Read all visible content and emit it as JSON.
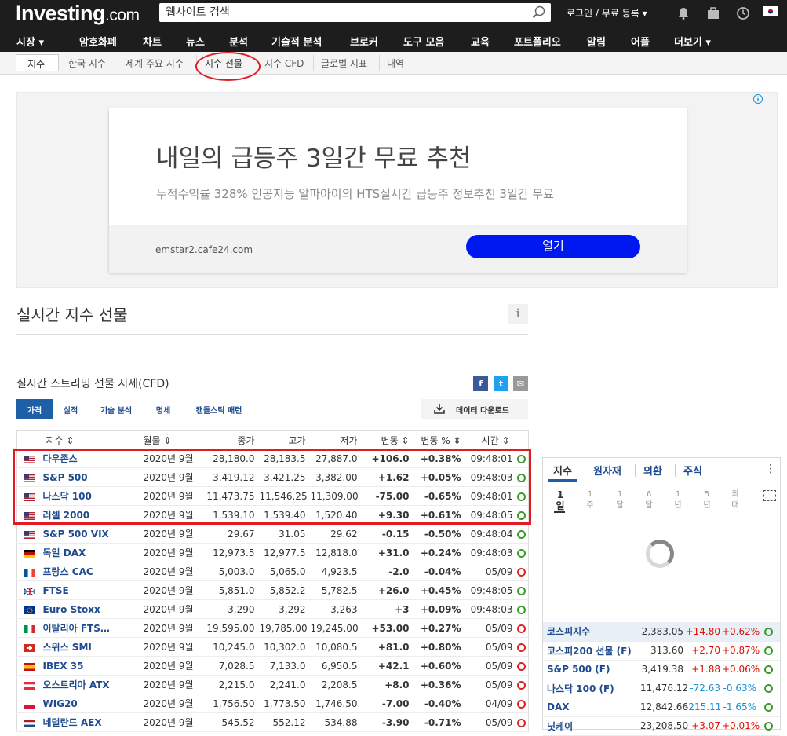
{
  "header": {
    "logo_main": "Investing",
    "logo_suffix": ".com",
    "search_placeholder": "웹사이트 검색",
    "login": "로그인 / 무료 등록",
    "login_arrow": "▾",
    "brand_color": "#1d1d1d"
  },
  "nav": [
    {
      "label": "시장 ▾"
    },
    {
      "label": "암호화폐"
    },
    {
      "label": "차트"
    },
    {
      "label": "뉴스"
    },
    {
      "label": "분석"
    },
    {
      "label": "기술적 분석"
    },
    {
      "label": "브로커"
    },
    {
      "label": "도구 모음"
    },
    {
      "label": "교육"
    },
    {
      "label": "포트폴리오"
    },
    {
      "label": "알림"
    },
    {
      "label": "어플"
    },
    {
      "label": "더보기 ▾"
    }
  ],
  "subnav": {
    "first": "지수",
    "items": [
      "한국 지수",
      "세계 주요 지수",
      "지수 선물",
      "지수 CFD",
      "글로벌 지표",
      "내역"
    ]
  },
  "ad": {
    "title": "내일의 급등주 3일간 무료 추천",
    "subtitle": "누적수익률 328% 인공지능 알파아이의 HTS실시간 급등주 정보추천 3일간 무료",
    "url": "emstar2.cafe24.com",
    "button": "열기",
    "button_color": "#0018f0"
  },
  "page": {
    "title": "실시간 지수 선물",
    "info": "i",
    "table_title": "실시간 스트리밍 선물 시세(CFD)"
  },
  "share": {
    "facebook": "f",
    "twitter": "t",
    "email": "✉"
  },
  "tabs": [
    "가격",
    "실적",
    "기술 분석",
    "명세",
    "캔들스틱 패턴"
  ],
  "download": "데이터 다운로드",
  "table": {
    "headers": {
      "name": "지수 ⇕",
      "month": "월물 ⇕",
      "close": "종가",
      "high": "고가",
      "low": "저가",
      "chg": "변동 ⇕",
      "pct": "변동 % ⇕",
      "time": "시간 ⇕"
    },
    "rows": [
      {
        "flag": "us",
        "name": "다우존스",
        "month": "2020년 9월",
        "close": "28,180.0",
        "high": "28,183.5",
        "low": "27,887.0",
        "chg": "+106.0",
        "pct": "+0.38%",
        "time": "09:48:01",
        "live": true
      },
      {
        "flag": "us",
        "name": "S&P 500",
        "month": "2020년 9월",
        "close": "3,419.12",
        "high": "3,421.25",
        "low": "3,382.00",
        "chg": "+1.62",
        "pct": "+0.05%",
        "time": "09:48:03",
        "live": true
      },
      {
        "flag": "us",
        "name": "나스닥 100",
        "month": "2020년 9월",
        "close": "11,473.75",
        "high": "11,546.25",
        "low": "11,309.00",
        "chg": "-75.00",
        "pct": "-0.65%",
        "time": "09:48:01",
        "live": true
      },
      {
        "flag": "us",
        "name": "러셀 2000",
        "month": "2020년 9월",
        "close": "1,539.10",
        "high": "1,539.40",
        "low": "1,520.40",
        "chg": "+9.30",
        "pct": "+0.61%",
        "time": "09:48:05",
        "live": true
      },
      {
        "flag": "us",
        "name": "S&P 500 VIX",
        "month": "2020년 9월",
        "close": "29.67",
        "high": "31.05",
        "low": "29.62",
        "chg": "-0.15",
        "pct": "-0.50%",
        "time": "09:48:04",
        "live": true
      },
      {
        "flag": "de",
        "name": "독일 DAX",
        "month": "2020년 9월",
        "close": "12,973.5",
        "high": "12,977.5",
        "low": "12,818.0",
        "chg": "+31.0",
        "pct": "+0.24%",
        "time": "09:48:03",
        "live": true
      },
      {
        "flag": "fr",
        "name": "프랑스 CAC",
        "month": "2020년 9월",
        "close": "5,003.0",
        "high": "5,065.0",
        "low": "4,923.5",
        "chg": "-2.0",
        "pct": "-0.04%",
        "time": "05/09",
        "live": false
      },
      {
        "flag": "gb",
        "name": "FTSE",
        "month": "2020년 9월",
        "close": "5,851.0",
        "high": "5,852.2",
        "low": "5,782.5",
        "chg": "+26.0",
        "pct": "+0.45%",
        "time": "09:48:05",
        "live": true
      },
      {
        "flag": "eu",
        "name": "Euro Stoxx",
        "month": "2020년 9월",
        "close": "3,290",
        "high": "3,292",
        "low": "3,263",
        "chg": "+3",
        "pct": "+0.09%",
        "time": "09:48:03",
        "live": true
      },
      {
        "flag": "it",
        "name": "이탈리아 FTS…",
        "month": "2020년 9월",
        "close": "19,595.00",
        "high": "19,785.00",
        "low": "19,245.00",
        "chg": "+53.00",
        "pct": "+0.27%",
        "time": "05/09",
        "live": false
      },
      {
        "flag": "ch",
        "name": "스위스 SMI",
        "month": "2020년 9월",
        "close": "10,245.0",
        "high": "10,302.0",
        "low": "10,080.5",
        "chg": "+81.0",
        "pct": "+0.80%",
        "time": "05/09",
        "live": false
      },
      {
        "flag": "es",
        "name": "IBEX 35",
        "month": "2020년 9월",
        "close": "7,028.5",
        "high": "7,133.0",
        "low": "6,950.5",
        "chg": "+42.1",
        "pct": "+0.60%",
        "time": "05/09",
        "live": false
      },
      {
        "flag": "at",
        "name": "오스트리아 ATX",
        "month": "2020년 9월",
        "close": "2,215.0",
        "high": "2,241.0",
        "low": "2,208.5",
        "chg": "+8.0",
        "pct": "+0.36%",
        "time": "05/09",
        "live": false
      },
      {
        "flag": "pl",
        "name": "WIG20",
        "month": "2020년 9월",
        "close": "1,756.50",
        "high": "1,773.50",
        "low": "1,746.50",
        "chg": "-7.00",
        "pct": "-0.40%",
        "time": "04/09",
        "live": false
      },
      {
        "flag": "nl",
        "name": "네덜란드 AEX",
        "month": "2020년 9월",
        "close": "545.52",
        "high": "552.12",
        "low": "534.88",
        "chg": "-3.90",
        "pct": "-0.71%",
        "time": "05/09",
        "live": false
      }
    ]
  },
  "side": {
    "tabs": [
      "지수",
      "원자재",
      "외환",
      "주식"
    ],
    "periods": [
      "1\n일",
      "1\n주",
      "1\n달",
      "6\n달",
      "1\n년",
      "5\n년",
      "최\n대"
    ],
    "rows": [
      {
        "name": "코스피지수",
        "price": "2,383.05",
        "chg": "+14.80",
        "pct": "+0.62%"
      },
      {
        "name": "코스피200 선물 (F)",
        "price": "313.60",
        "chg": "+2.70",
        "pct": "+0.87%"
      },
      {
        "name": "S&P 500 (F)",
        "price": "3,419.38",
        "chg": "+1.88",
        "pct": "+0.06%"
      },
      {
        "name": "나스닥 100 (F)",
        "price": "11,476.12",
        "chg": "-72.63",
        "pct": "-0.63%"
      },
      {
        "name": "DAX",
        "price": "12,842.66",
        "chg": "-215.11",
        "pct": "-1.65%"
      },
      {
        "name": "닛케이",
        "price": "23,208.50",
        "chg": "+3.07",
        "pct": "+0.01%"
      }
    ]
  },
  "colors": {
    "positive": "#e01000",
    "negative": "#1a8fd6",
    "link": "#1f4b8e",
    "highlight": "#e31b23"
  }
}
